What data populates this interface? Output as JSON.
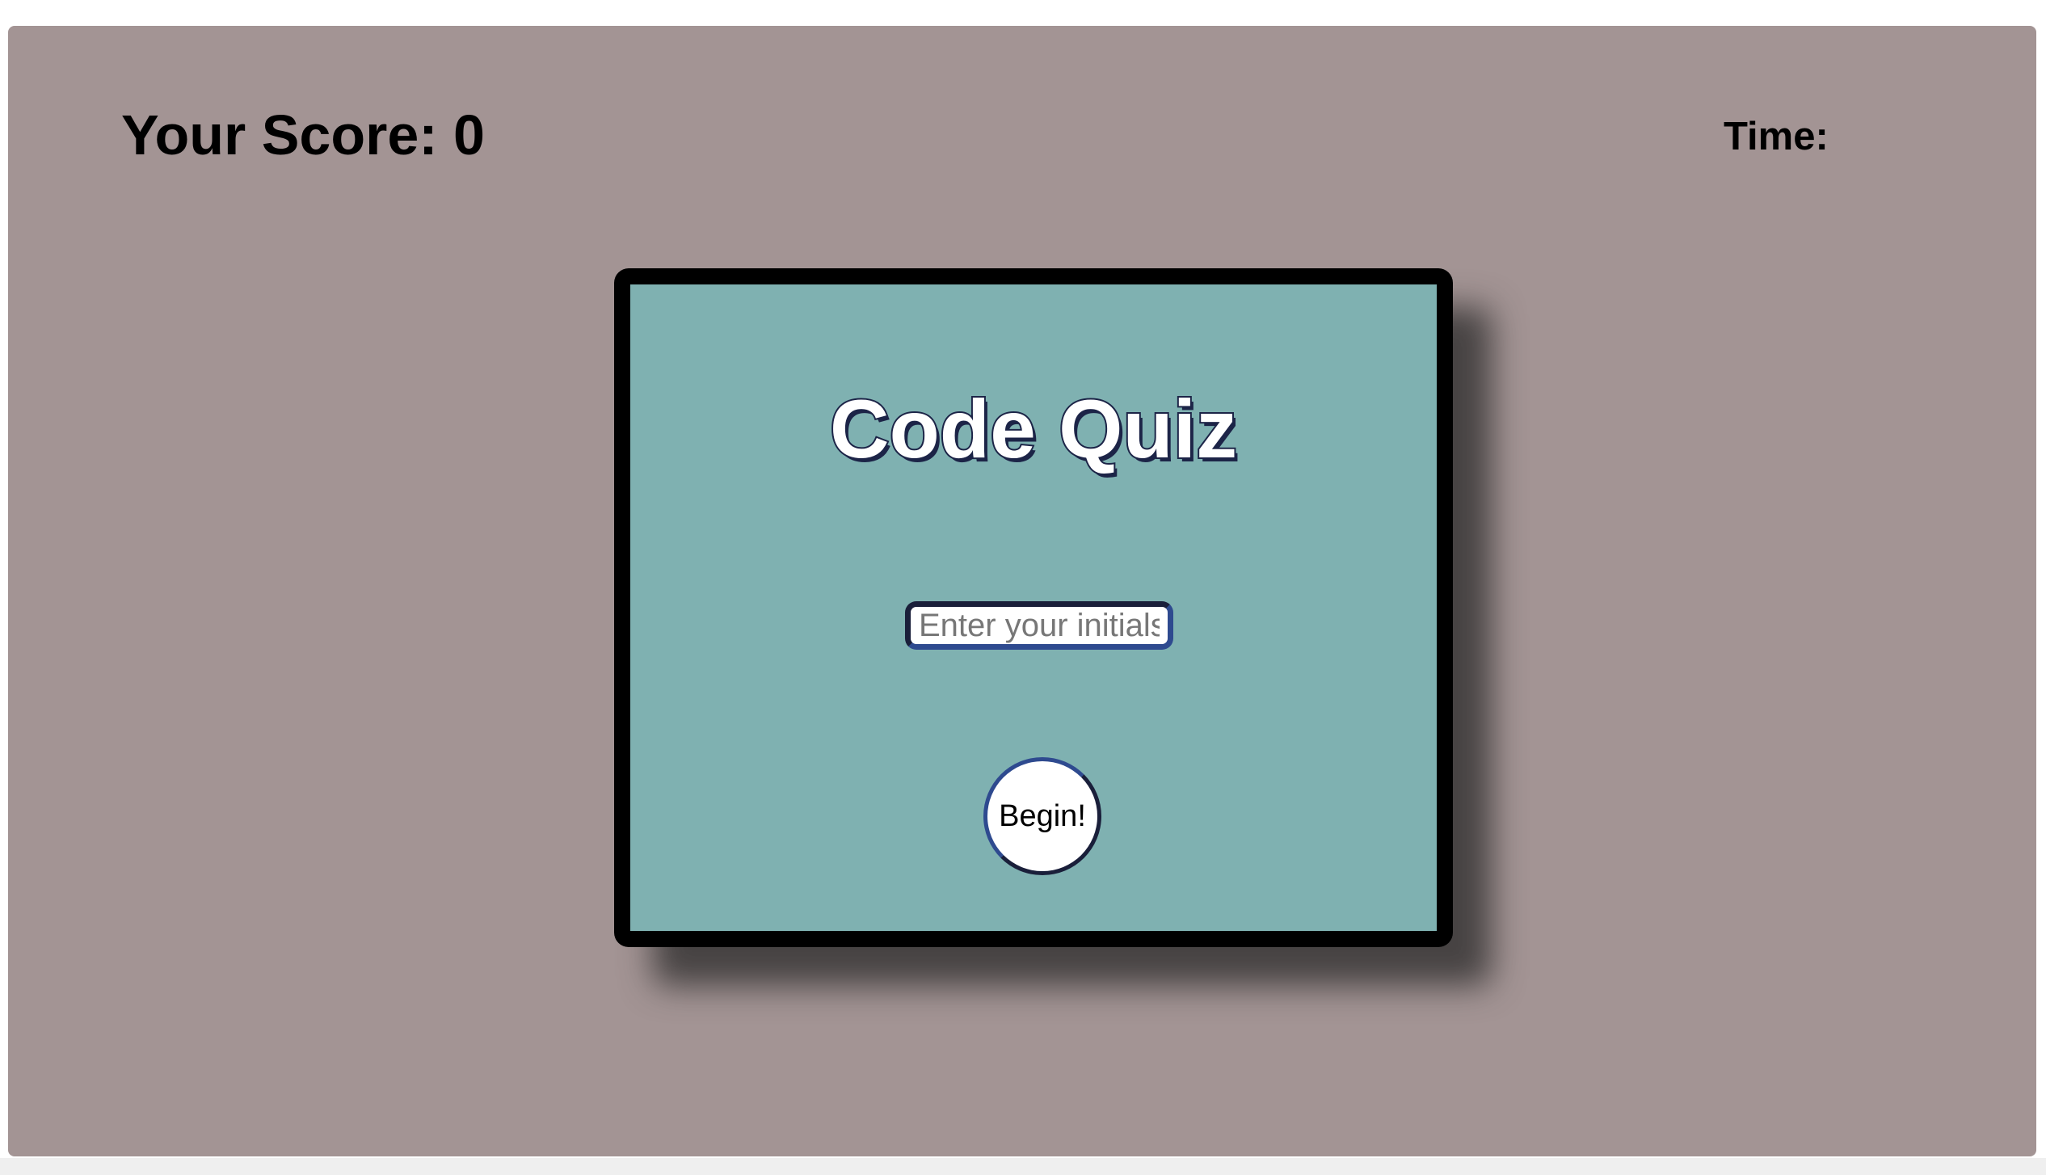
{
  "header": {
    "score_label": "Your Score: 0",
    "time_label": "Time:"
  },
  "quiz": {
    "title": "Code Quiz",
    "initials_placeholder": "Enter your initials",
    "initials_value": "",
    "begin_label": "Begin!"
  },
  "colors": {
    "page_background": "#a39494",
    "card_background": "#7fb1b1",
    "card_border": "#000000",
    "title_outline": "#1c2447",
    "accent_navy": "#2e4a8f"
  }
}
